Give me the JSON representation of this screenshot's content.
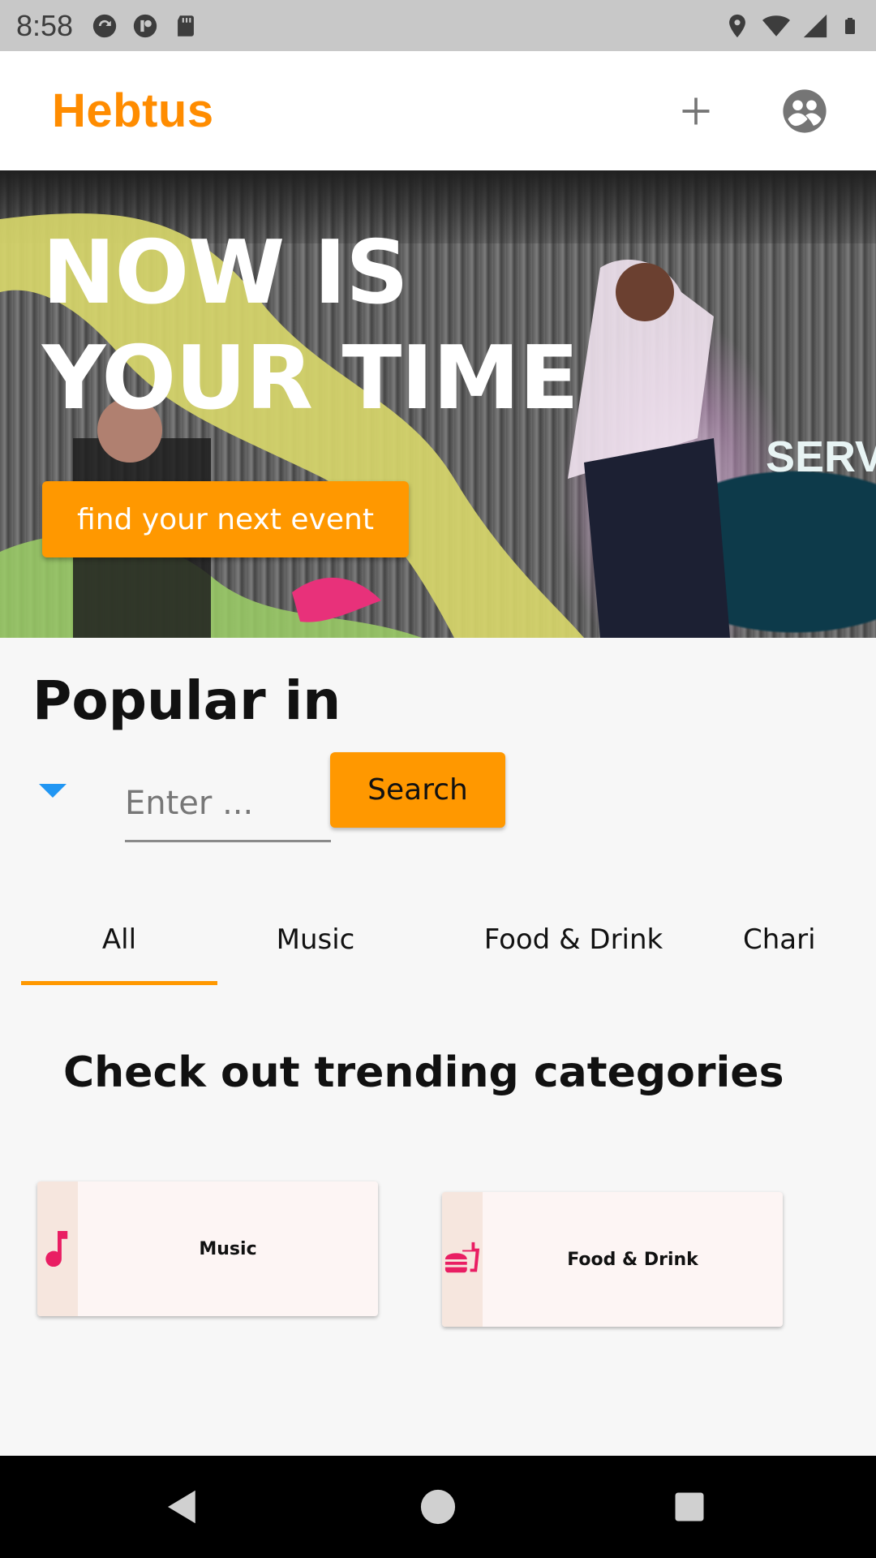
{
  "status_bar": {
    "time": "8:58",
    "left_icons": [
      "sync-icon",
      "app-icon",
      "sd-card-icon"
    ],
    "right_icons": [
      "location-icon",
      "wifi-icon",
      "signal-icon",
      "battery-icon"
    ]
  },
  "app_bar": {
    "title": "Hebtus",
    "brand_color": "#ff8c00",
    "actions": [
      "add-icon",
      "account-circle-icon"
    ]
  },
  "hero": {
    "headline_line1": "NOW IS",
    "headline_line2": "YOUR TIME",
    "button_label": "find your next event",
    "background_sign": "SERV"
  },
  "popular": {
    "title": "Popular in",
    "search_placeholder": "Enter ...",
    "search_button": "Search"
  },
  "tabs": {
    "items": [
      "All",
      "Music",
      "Food & Drink",
      "Charity"
    ],
    "selected": "All"
  },
  "trending": {
    "title": "Check out trending categories",
    "categories": [
      {
        "label": "Music",
        "icon": "music-note-icon"
      },
      {
        "label": "Food & Drink",
        "icon": "fastfood-icon"
      }
    ]
  },
  "colors": {
    "accent": "#ff9800",
    "dropdown": "#2196f3",
    "category_icon": "#e91e63"
  },
  "nav_bar": {
    "buttons": [
      "back-icon",
      "home-icon",
      "recents-icon"
    ]
  }
}
